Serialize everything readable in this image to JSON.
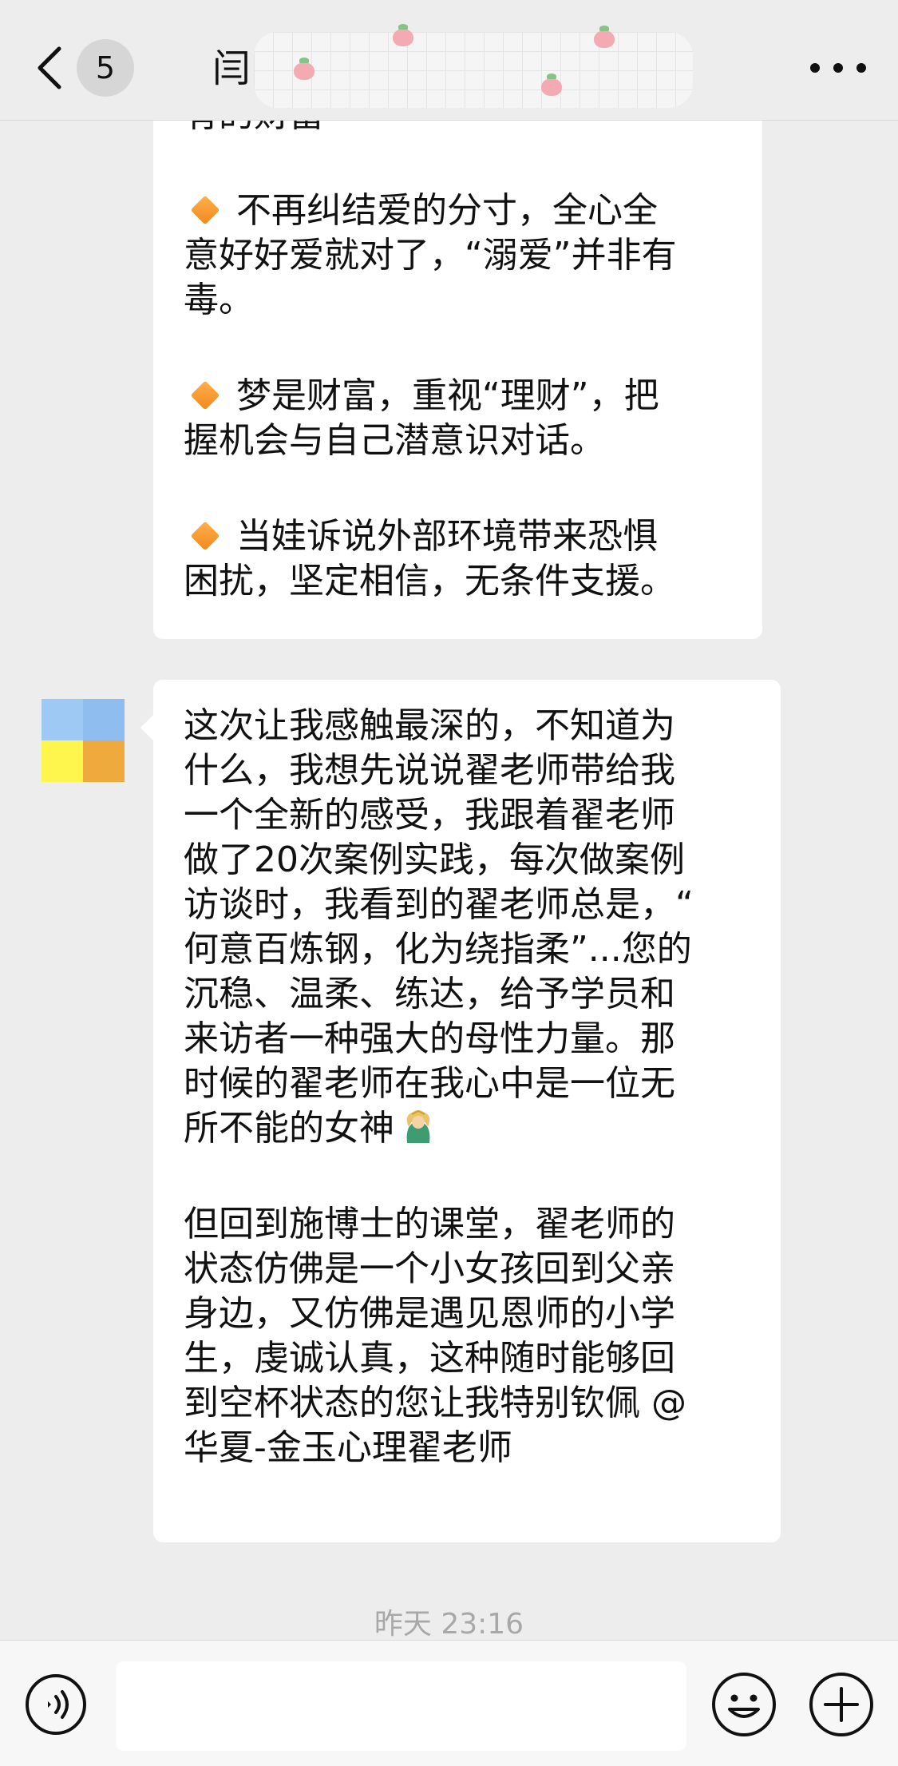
{
  "header": {
    "unread_count": "5",
    "title_visible": "闫"
  },
  "messages": [
    {
      "id": "msg-1",
      "lines_partial_top": [
        "有的财富"
      ],
      "bullets": [
        {
          "lines": [
            "不再纠结爱的分寸，全心全",
            "意好好爱就对了，“溺爱”并非有",
            "毒。"
          ]
        },
        {
          "lines": [
            "梦是财富，重视“理财”，把",
            "握机会与自己潜意识对话。"
          ]
        },
        {
          "lines": [
            "当娃诉说外部环境带来恐惧",
            "困扰，坚定相信，无条件支援。"
          ]
        }
      ]
    },
    {
      "id": "msg-2",
      "paragraph_1": [
        "这次让我感触最深的，不知道为",
        "什么，我想先说说翟老师带给我",
        "一个全新的感受，我跟着翟老师",
        "做了20次案例实践，每次做案例",
        "访谈时，我看到的翟老师总是，“",
        "何意百炼钢，化为绕指柔”...您的",
        "沉稳、温柔、练达，给予学员和",
        "来访者一种强大的母性力量。那",
        "时候的翟老师在我心中是一位无",
        "所不能的女神"
      ],
      "paragraph_2": [
        "但回到施博士的课堂，翟老师的",
        "状态仿佛是一个小女孩回到父亲",
        "身边，又仿佛是遇见恩师的小学",
        "生，虔诚认真，这种随时能够回",
        "到空杯状态的您让我特别钦佩 @",
        "华夏-金玉心理翟老师"
      ]
    }
  ],
  "timestamp": "昨天 23:16",
  "input_bar": {
    "value": "",
    "placeholder": ""
  },
  "icons": {
    "back": "chevron-left-icon",
    "more": "more-dots-icon",
    "bullet": "orange-diamond-icon",
    "emoji": "goddess-emoji-icon",
    "voice": "voice-icon",
    "sticker": "smiley-icon",
    "plus": "plus-icon"
  },
  "colors": {
    "background": "#ededed",
    "bubble": "#ffffff",
    "diamond": "#f0891e",
    "timestamp": "#a8a8a8"
  }
}
